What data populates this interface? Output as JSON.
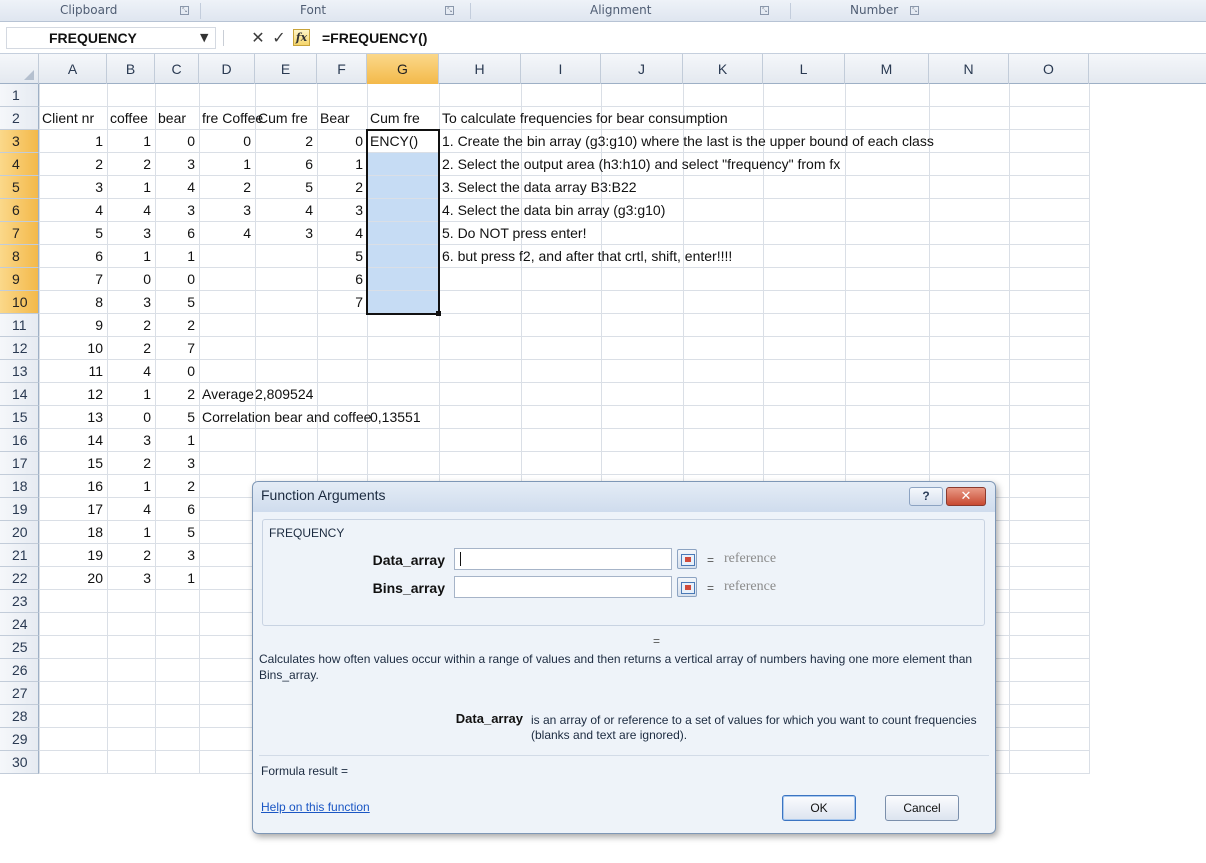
{
  "ribbon": {
    "groups": [
      {
        "label": "Clipboard"
      },
      {
        "label": "Font"
      },
      {
        "label": "Alignment"
      },
      {
        "label": "Number"
      }
    ],
    "launcher_glyph": "⤡"
  },
  "formula_bar": {
    "name_box": "FREQUENCY",
    "cancel_glyph": "✕",
    "enter_glyph": "✓",
    "fx_label": "fx",
    "formula": "=FREQUENCY()"
  },
  "columns": [
    "A",
    "B",
    "C",
    "D",
    "E",
    "F",
    "G",
    "H",
    "I",
    "J",
    "K",
    "L",
    "M",
    "N",
    "O"
  ],
  "selected_column": "G",
  "rows": [
    {
      "n": "1",
      "cells": {}
    },
    {
      "n": "2",
      "cells": {
        "A": "Client nr",
        "B": "coffee",
        "C": "bear",
        "D": "fre Coffee",
        "E": "Cum fre",
        "F": "Bear",
        "G": "Cum fre",
        "H": "To calculate frequencies for bear consumption"
      }
    },
    {
      "n": "3",
      "cells": {
        "A": "1",
        "B": "1",
        "C": "0",
        "D": "0",
        "E": "2",
        "F": "0",
        "G": "ENCY()",
        "H": "1. Create the bin array (g3:g10) where the last is the upper bound of each class"
      }
    },
    {
      "n": "4",
      "cells": {
        "A": "2",
        "B": "2",
        "C": "3",
        "D": "1",
        "E": "6",
        "F": "1",
        "H": "2. Select the output area (h3:h10) and select \"frequency\" from fx"
      }
    },
    {
      "n": "5",
      "cells": {
        "A": "3",
        "B": "1",
        "C": "4",
        "D": "2",
        "E": "5",
        "F": "2",
        "H": "3. Select the data array B3:B22"
      }
    },
    {
      "n": "6",
      "cells": {
        "A": "4",
        "B": "4",
        "C": "3",
        "D": "3",
        "E": "4",
        "F": "3",
        "H": "4. Select the data bin array (g3:g10)"
      }
    },
    {
      "n": "7",
      "cells": {
        "A": "5",
        "B": "3",
        "C": "6",
        "D": "4",
        "E": "3",
        "F": "4",
        "H": "5. Do NOT press enter!"
      }
    },
    {
      "n": "8",
      "cells": {
        "A": "6",
        "B": "1",
        "C": "1",
        "F": "5",
        "H": "6. but press f2, and after that crtl, shift, enter!!!!"
      }
    },
    {
      "n": "9",
      "cells": {
        "A": "7",
        "B": "0",
        "C": "0",
        "F": "6"
      }
    },
    {
      "n": "10",
      "cells": {
        "A": "8",
        "B": "3",
        "C": "5",
        "F": "7"
      }
    },
    {
      "n": "11",
      "cells": {
        "A": "9",
        "B": "2",
        "C": "2"
      }
    },
    {
      "n": "12",
      "cells": {
        "A": "10",
        "B": "2",
        "C": "7"
      }
    },
    {
      "n": "13",
      "cells": {
        "A": "11",
        "B": "4",
        "C": "0"
      }
    },
    {
      "n": "14",
      "cells": {
        "A": "12",
        "B": "1",
        "C": "2",
        "D": "Average",
        "E": "2,809524"
      }
    },
    {
      "n": "15",
      "cells": {
        "A": "13",
        "B": "0",
        "C": "5",
        "D": "Correlation bear and coffee",
        "G": "0,13551"
      }
    },
    {
      "n": "16",
      "cells": {
        "A": "14",
        "B": "3",
        "C": "1"
      }
    },
    {
      "n": "17",
      "cells": {
        "A": "15",
        "B": "2",
        "C": "3"
      }
    },
    {
      "n": "18",
      "cells": {
        "A": "16",
        "B": "1",
        "C": "2"
      }
    },
    {
      "n": "19",
      "cells": {
        "A": "17",
        "B": "4",
        "C": "6"
      }
    },
    {
      "n": "20",
      "cells": {
        "A": "18",
        "B": "1",
        "C": "5"
      }
    },
    {
      "n": "21",
      "cells": {
        "A": "19",
        "B": "2",
        "C": "3"
      }
    },
    {
      "n": "22",
      "cells": {
        "A": "20",
        "B": "3",
        "C": "1"
      }
    },
    {
      "n": "23",
      "cells": {}
    },
    {
      "n": "24",
      "cells": {}
    },
    {
      "n": "25",
      "cells": {}
    },
    {
      "n": "26",
      "cells": {}
    },
    {
      "n": "27",
      "cells": {}
    },
    {
      "n": "28",
      "cells": {}
    },
    {
      "n": "29",
      "cells": {}
    },
    {
      "n": "30",
      "cells": {}
    }
  ],
  "selected_rows": [
    "3",
    "4",
    "5",
    "6",
    "7",
    "8",
    "9",
    "10"
  ],
  "dialog": {
    "title": "Function Arguments",
    "help_glyph": "?",
    "close_glyph": "✕",
    "function_name": "FREQUENCY",
    "args": [
      {
        "label": "Data_array",
        "value": "",
        "result": "reference"
      },
      {
        "label": "Bins_array",
        "value": "",
        "result": "reference"
      }
    ],
    "eq": "=",
    "result_eq": "=",
    "description": "Calculates how often values occur within a range of values and then returns a vertical array of numbers having one more element than Bins_array.",
    "arg_desc_name": "Data_array",
    "arg_desc_text": "is an array of or reference to a set of values for which you want to count frequencies (blanks and text are ignored).",
    "formula_result": "Formula result =",
    "help_link": "Help on this function",
    "ok_label": "OK",
    "cancel_label": "Cancel"
  },
  "colors": {
    "selection_fill": "#c6dcf4",
    "header_selected": "#f3b94a",
    "close_button": "#c84a32",
    "link": "#1a56c4"
  }
}
